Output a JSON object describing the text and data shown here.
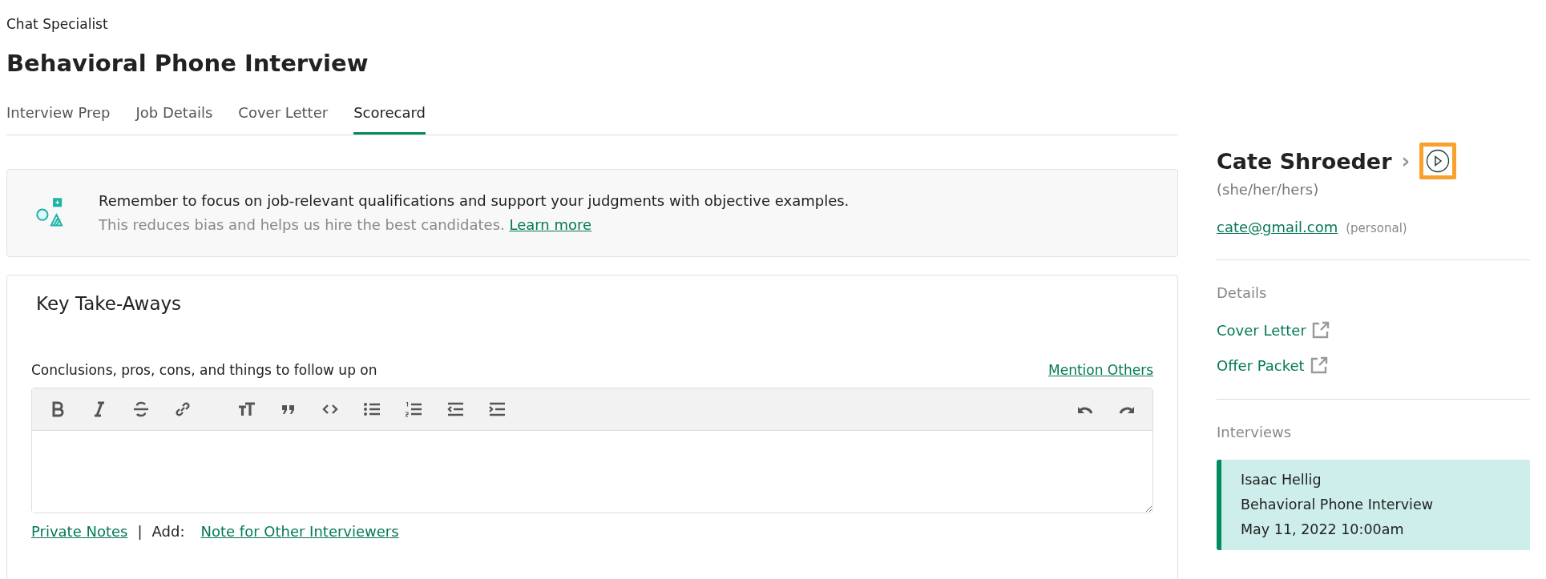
{
  "header": {
    "job": "Chat Specialist",
    "title": "Behavioral Phone Interview"
  },
  "tabs": [
    {
      "label": "Interview Prep",
      "selected": false
    },
    {
      "label": "Job Details",
      "selected": false
    },
    {
      "label": "Cover Letter",
      "selected": false
    },
    {
      "label": "Scorecard",
      "selected": true
    }
  ],
  "notice": {
    "message": "Remember to focus on job-relevant qualifications and support your judgments with objective examples.",
    "detail": "This reduces bias and helps us hire the best candidates.",
    "link": "Learn more"
  },
  "section": {
    "title": "Key Take-Aways",
    "prompt": "Conclusions, pros, cons, and things to follow up on",
    "mention_link": "Mention Others",
    "toolbar": {
      "groups": [
        [
          {
            "kind": "bold"
          },
          {
            "kind": "italic"
          },
          {
            "kind": "strike"
          },
          {
            "kind": "link"
          }
        ],
        [
          {
            "kind": "heading"
          },
          {
            "kind": "quote"
          },
          {
            "kind": "code"
          },
          {
            "kind": "bullets"
          },
          {
            "kind": "numbers"
          },
          {
            "kind": "outdent"
          },
          {
            "kind": "indent"
          }
        ]
      ],
      "history": [
        {
          "kind": "undo"
        },
        {
          "kind": "redo"
        }
      ]
    },
    "footer": {
      "private_link": "Private Notes",
      "separator": "|",
      "add_label": "Add:",
      "note_link": "Note for Other Interviewers"
    }
  },
  "candidate": {
    "name": "Cate Shroeder",
    "chevron": "›",
    "play_highlighted": true,
    "pronouns": "(she/her/hers)",
    "email": "cate@gmail.com",
    "email_type": "(personal)"
  },
  "details": {
    "heading": "Details",
    "links": [
      "Cover Letter",
      "Offer Packet"
    ]
  },
  "interviews": {
    "heading": "Interviews",
    "items": [
      {
        "interviewer": "Isaac Hellig",
        "type": "Behavioral Phone Interview",
        "when": "May 11, 2022 10:00am",
        "selected": true
      }
    ]
  }
}
